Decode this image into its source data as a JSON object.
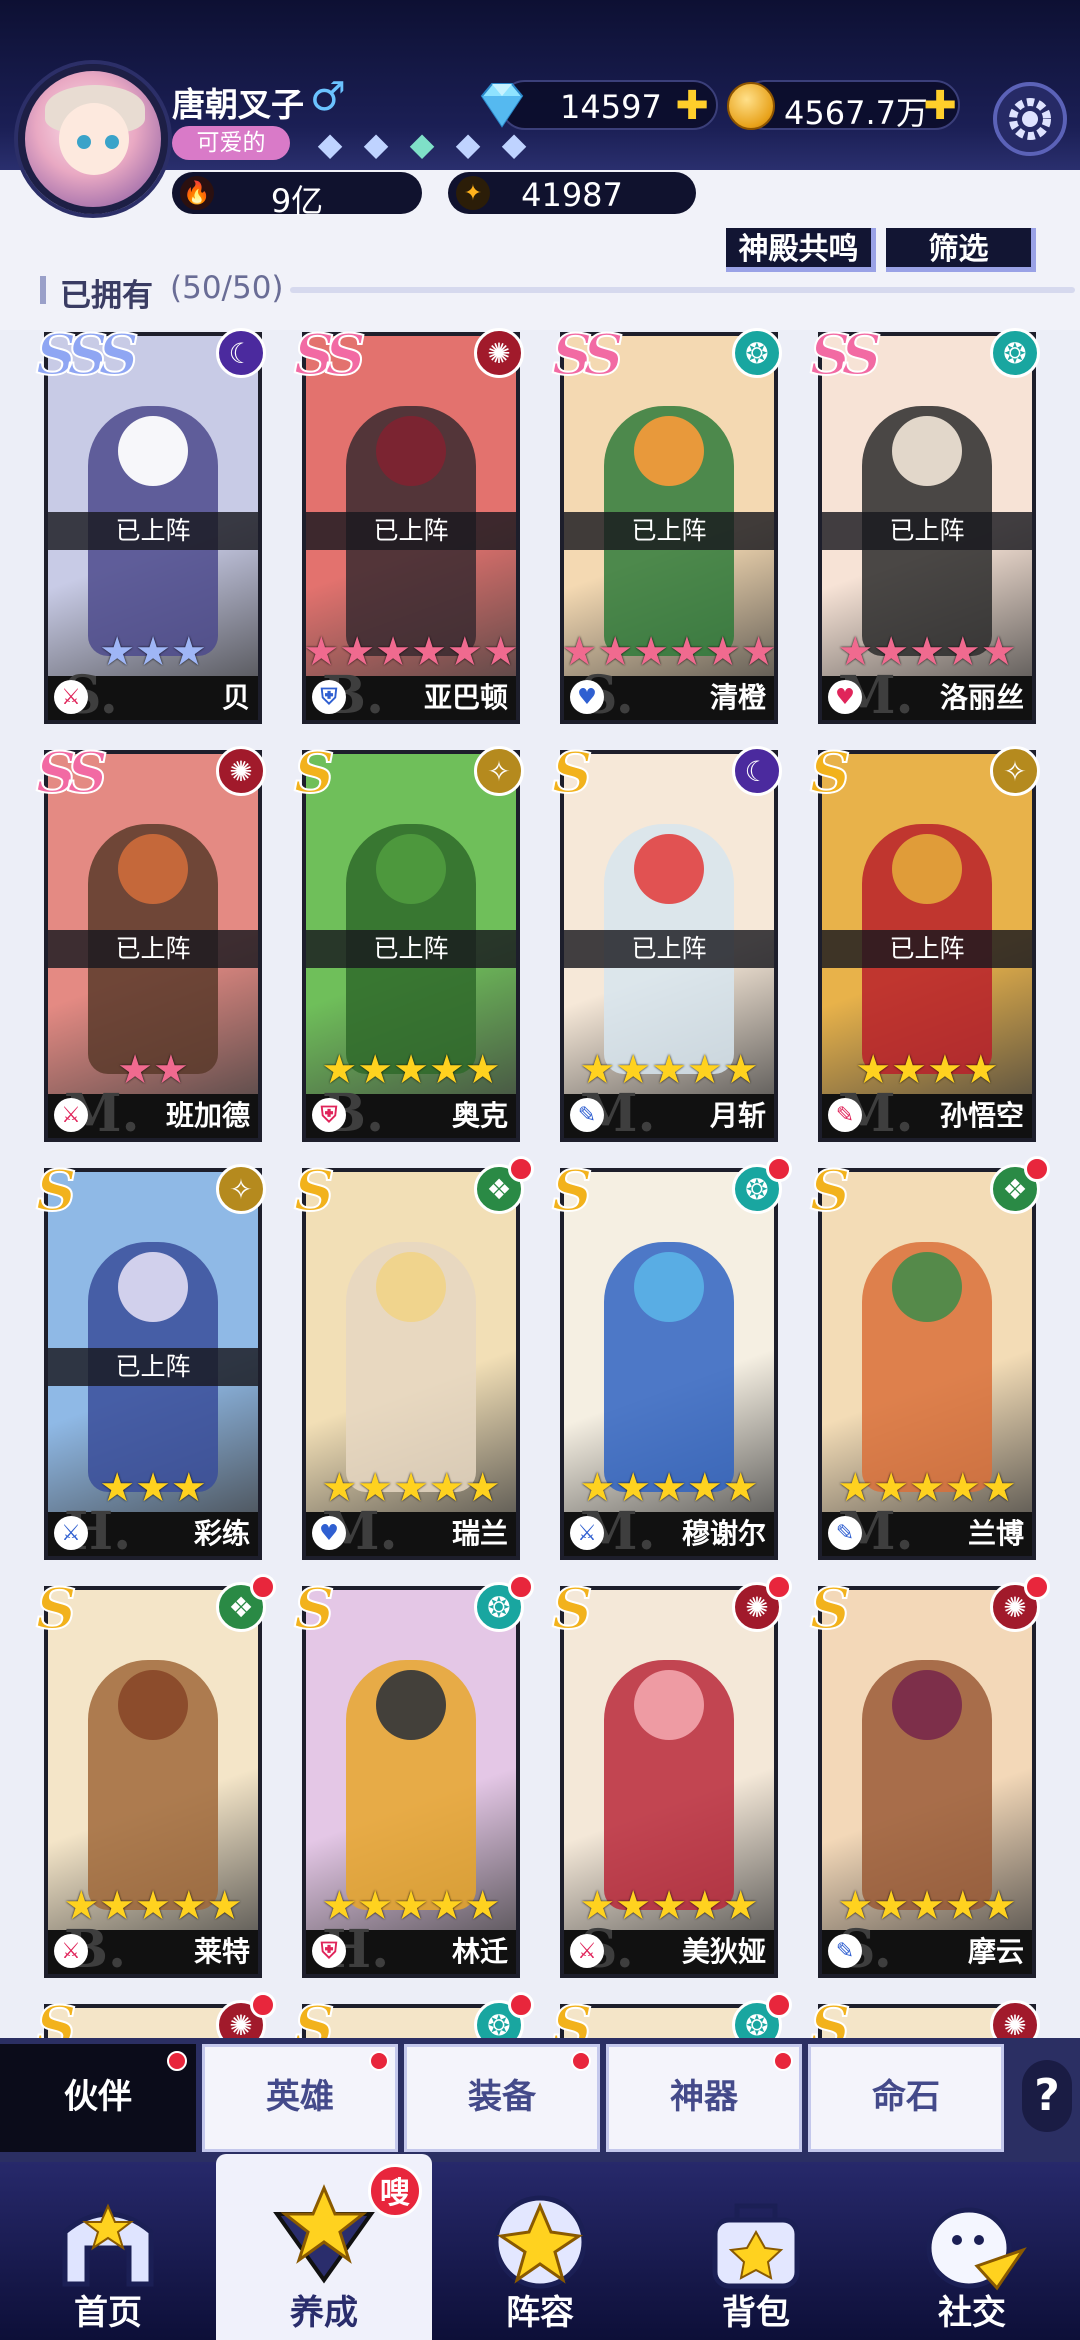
{
  "player": {
    "name": "唐朝叉子",
    "gender_symbol": "♂",
    "title_badge": "可爱的",
    "rank_gems": [
      "◆",
      "◆",
      "◆",
      "◆",
      "◆"
    ]
  },
  "currency": {
    "diamonds": "14597",
    "coins": "4567.7万",
    "add_symbol": "✚"
  },
  "stats": {
    "power": "9亿",
    "score": "41987"
  },
  "header_buttons": {
    "resonance": "神殿共鸣",
    "filter": "筛选"
  },
  "owned": {
    "label": "已拥有",
    "count": "(50/50)"
  },
  "deployed_label": "已上阵",
  "heroes": [
    {
      "name": "贝",
      "rarity": "SSS",
      "stars": 3,
      "deployed": true,
      "class_icon": "sword",
      "class_color": "#e0245a",
      "element": "moon",
      "element_color": "#4b2a9e",
      "bg": "#c8cbe6",
      "fg": "#4c4a8c",
      "head": "#ffffff",
      "rarity_color": "#8fa6f3",
      "star_color": "#9fb6f6",
      "watermark": "S.",
      "red_dot": false
    },
    {
      "name": "亚巴顿",
      "rarity": "SS",
      "stars": 6,
      "deployed": true,
      "class_icon": "shield",
      "class_color": "#2f5fd1",
      "element": "fire",
      "element_color": "#a11a2b",
      "bg": "#e3726e",
      "fg": "#3a2a30",
      "head": "#7d2430",
      "rarity_color": "#f26aa3",
      "star_color": "#f06a8f",
      "watermark": "B.",
      "red_dot": false
    },
    {
      "name": "清橙",
      "rarity": "SS",
      "stars": 6,
      "deployed": true,
      "class_icon": "heart",
      "class_color": "#2f5fd1",
      "element": "wind",
      "element_color": "#19a6a0",
      "bg": "#f4d9b2",
      "fg": "#2f7a3a",
      "head": "#f09a3a",
      "rarity_color": "#f26aa3",
      "star_color": "#f06a8f",
      "watermark": "S.",
      "red_dot": false
    },
    {
      "name": "洛丽丝",
      "rarity": "SS",
      "stars": 5,
      "deployed": true,
      "class_icon": "heart",
      "class_color": "#e0245a",
      "element": "wind",
      "element_color": "#19a6a0",
      "bg": "#f7e3d6",
      "fg": "#2b2b2b",
      "head": "#eadfd2",
      "rarity_color": "#f26aa3",
      "star_color": "#f06a8f",
      "watermark": "M.",
      "red_dot": false
    },
    {
      "name": "班加德",
      "rarity": "SS",
      "stars": 2,
      "deployed": true,
      "class_icon": "sword",
      "class_color": "#e0245a",
      "element": "fire",
      "element_color": "#a11a2b",
      "bg": "#e48a83",
      "fg": "#5a3a2a",
      "head": "#c96a3a",
      "rarity_color": "#f26aa3",
      "star_color": "#f06a8f",
      "watermark": "M.",
      "red_dot": false
    },
    {
      "name": "奥克",
      "rarity": "S",
      "stars": 5,
      "deployed": true,
      "class_icon": "shield",
      "class_color": "#e0245a",
      "element": "light",
      "element_color": "#b58a1e",
      "bg": "#6fbf5a",
      "fg": "#2f6a2a",
      "head": "#4e9a3e",
      "rarity_color": "#f2b21c",
      "star_color": "#ffd21f",
      "watermark": "B.",
      "red_dot": false
    },
    {
      "name": "月斩",
      "rarity": "S",
      "stars": 5,
      "deployed": true,
      "class_icon": "blade",
      "class_color": "#2f5fd1",
      "element": "moon",
      "element_color": "#4b2a9e",
      "bg": "#f6e8d8",
      "fg": "#d7e5ee",
      "head": "#e04a4a",
      "rarity_color": "#f2b21c",
      "star_color": "#ffd21f",
      "watermark": "M.",
      "red_dot": false
    },
    {
      "name": "孙悟空",
      "rarity": "S",
      "stars": 4,
      "deployed": true,
      "class_icon": "blade",
      "class_color": "#e0245a",
      "element": "light",
      "element_color": "#b58a1e",
      "bg": "#e8b24a",
      "fg": "#b8202a",
      "head": "#e2a23a",
      "rarity_color": "#f2b21c",
      "star_color": "#ffd21f",
      "watermark": "M.",
      "red_dot": false
    },
    {
      "name": "彩练",
      "rarity": "S",
      "stars": 3,
      "deployed": true,
      "class_icon": "sword",
      "class_color": "#2f5fd1",
      "element": "light",
      "element_color": "#b58a1e",
      "bg": "#8fb9e6",
      "fg": "#3a4d9a",
      "head": "#d9d6ef",
      "rarity_color": "#f2b21c",
      "star_color": "#ffd21f",
      "watermark": "H.",
      "red_dot": false
    },
    {
      "name": "瑞兰",
      "rarity": "S",
      "stars": 5,
      "deployed": false,
      "class_icon": "heart",
      "class_color": "#2f5fd1",
      "element": "earth",
      "element_color": "#2a8a45",
      "bg": "#f2dfb6",
      "fg": "#e6d7c2",
      "head": "#f0d48a",
      "rarity_color": "#f2b21c",
      "star_color": "#ffd21f",
      "watermark": "M.",
      "red_dot": true
    },
    {
      "name": "穆谢尔",
      "rarity": "S",
      "stars": 5,
      "deployed": false,
      "class_icon": "sword",
      "class_color": "#2f5fd1",
      "element": "wind",
      "element_color": "#19a6a0",
      "bg": "#f5efe2",
      "fg": "#2f63c2",
      "head": "#5ab0e6",
      "rarity_color": "#f2b21c",
      "star_color": "#ffd21f",
      "watermark": "M.",
      "red_dot": true
    },
    {
      "name": "兰博",
      "rarity": "S",
      "stars": 5,
      "deployed": false,
      "class_icon": "blade",
      "class_color": "#2f5fd1",
      "element": "earth",
      "element_color": "#2a8a45",
      "bg": "#f3dcb6",
      "fg": "#d9703a",
      "head": "#4d8a4a",
      "rarity_color": "#f2b21c",
      "star_color": "#ffd21f",
      "watermark": "M.",
      "red_dot": true
    },
    {
      "name": "莱特",
      "rarity": "S",
      "stars": 5,
      "deployed": false,
      "class_icon": "sword",
      "class_color": "#e0245a",
      "element": "earth",
      "element_color": "#2a8a45",
      "bg": "#f4e5c8",
      "fg": "#a0683a",
      "head": "#8a4a2a",
      "rarity_color": "#f2b21c",
      "star_color": "#ffd21f",
      "watermark": "B.",
      "red_dot": true
    },
    {
      "name": "林迁",
      "rarity": "S",
      "stars": 5,
      "deployed": false,
      "class_icon": "shield",
      "class_color": "#e0245a",
      "element": "wind",
      "element_color": "#19a6a0",
      "bg": "#e4c7e6",
      "fg": "#e7a62a",
      "head": "#3a3a3a",
      "rarity_color": "#f2b21c",
      "star_color": "#ffd21f",
      "watermark": "H.",
      "red_dot": true
    },
    {
      "name": "美狄娅",
      "rarity": "S",
      "stars": 5,
      "deployed": false,
      "class_icon": "sword",
      "class_color": "#e0245a",
      "element": "fire",
      "element_color": "#a11a2b",
      "bg": "#f4e8d8",
      "fg": "#b8283a",
      "head": "#f0a0a8",
      "rarity_color": "#f2b21c",
      "star_color": "#ffd21f",
      "watermark": "S.",
      "red_dot": true
    },
    {
      "name": "摩云",
      "rarity": "S",
      "stars": 5,
      "deployed": false,
      "class_icon": "blade",
      "class_color": "#2f5fd1",
      "element": "fire",
      "element_color": "#a11a2b",
      "bg": "#f3d8b8",
      "fg": "#9a5a36",
      "head": "#7a2c4a",
      "rarity_color": "#f2b21c",
      "star_color": "#ffd21f",
      "watermark": "S.",
      "red_dot": true
    },
    {
      "name": "",
      "rarity": "S",
      "stars": 0,
      "deployed": false,
      "class_icon": "sword",
      "class_color": "#e0245a",
      "element": "fire",
      "element_color": "#a11a2b",
      "bg": "#f4e5c8",
      "fg": "#c04a3a",
      "head": "#c04a3a",
      "rarity_color": "#f2b21c",
      "star_color": "#ffd21f",
      "watermark": "",
      "red_dot": true
    },
    {
      "name": "",
      "rarity": "S",
      "stars": 0,
      "deployed": false,
      "class_icon": "sword",
      "class_color": "#e0245a",
      "element": "wind",
      "element_color": "#19a6a0",
      "bg": "#f4e5c8",
      "fg": "#3a7aa0",
      "head": "#3a7aa0",
      "rarity_color": "#f2b21c",
      "star_color": "#ffd21f",
      "watermark": "",
      "red_dot": true
    },
    {
      "name": "",
      "rarity": "S",
      "stars": 0,
      "deployed": false,
      "class_icon": "sword",
      "class_color": "#e0245a",
      "element": "wind",
      "element_color": "#19a6a0",
      "bg": "#f4e5c8",
      "fg": "#3a7aa0",
      "head": "#3a7aa0",
      "rarity_color": "#f2b21c",
      "star_color": "#ffd21f",
      "watermark": "",
      "red_dot": true
    },
    {
      "name": "",
      "rarity": "S",
      "stars": 0,
      "deployed": false,
      "class_icon": "sword",
      "class_color": "#e0245a",
      "element": "fire",
      "element_color": "#a11a2b",
      "bg": "#f4e5c8",
      "fg": "#9a4a3a",
      "head": "#9a4a3a",
      "rarity_color": "#f2b21c",
      "star_color": "#ffd21f",
      "watermark": "",
      "red_dot": false
    }
  ],
  "tabs": [
    {
      "label": "伙伴",
      "active": true,
      "dot": true
    },
    {
      "label": "英雄",
      "active": false,
      "dot": true
    },
    {
      "label": "装备",
      "active": false,
      "dot": true
    },
    {
      "label": "神器",
      "active": false,
      "dot": true
    },
    {
      "label": "命石",
      "active": false,
      "dot": false
    }
  ],
  "help_label": "?",
  "nav": [
    {
      "label": "首页",
      "icon": "home-icon",
      "active": false
    },
    {
      "label": "养成",
      "icon": "cultivate-icon",
      "active": true,
      "badge": "嗖"
    },
    {
      "label": "阵容",
      "icon": "lineup-icon",
      "active": false
    },
    {
      "label": "背包",
      "icon": "bag-icon",
      "active": false
    },
    {
      "label": "社交",
      "icon": "social-icon",
      "active": false
    }
  ],
  "colors": {
    "accent_dark": "#1b1f55",
    "gold": "#ffcf2b",
    "badge_red": "#e8263c"
  }
}
